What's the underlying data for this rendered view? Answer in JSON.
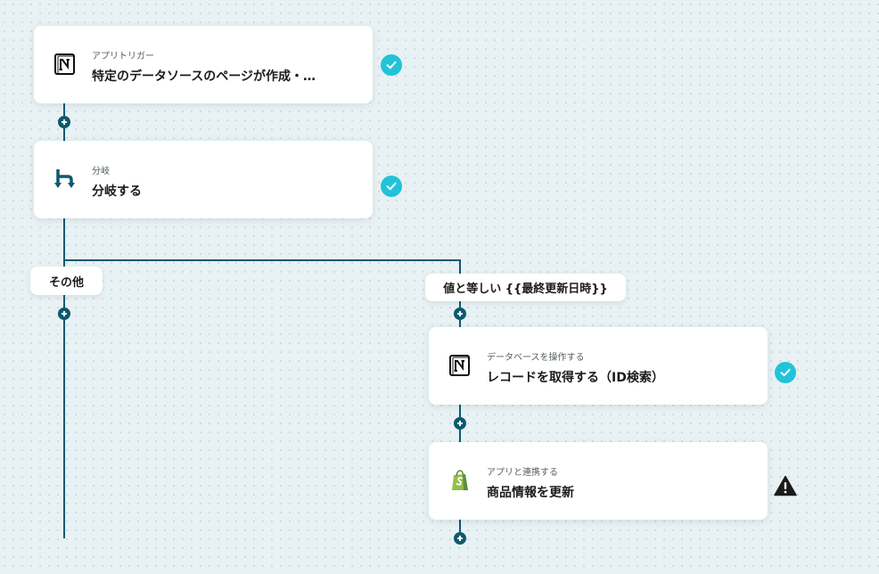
{
  "steps": [
    {
      "subtitle": "アプリトリガー",
      "title": "特定のデータソースのページが作成・…",
      "icon": "notion-icon",
      "status": "complete"
    },
    {
      "subtitle": "分岐",
      "title": "分岐する",
      "icon": "branch-icon",
      "status": "complete"
    },
    {
      "subtitle": "データベースを操作する",
      "title": "レコードを取得する（ID検索）",
      "icon": "notion-icon",
      "status": "complete"
    },
    {
      "subtitle": "アプリと連携する",
      "title": "商品情報を更新",
      "icon": "shopify-icon",
      "status": "warning"
    }
  ],
  "branches": {
    "other_label": "その他",
    "condition_label": "値と等しい {{最終更新日時}}"
  },
  "colors": {
    "connector": "#0b5a6e",
    "check": "#22c3d8",
    "warning": "#1b1b1b",
    "shopify": "#95bf47"
  }
}
